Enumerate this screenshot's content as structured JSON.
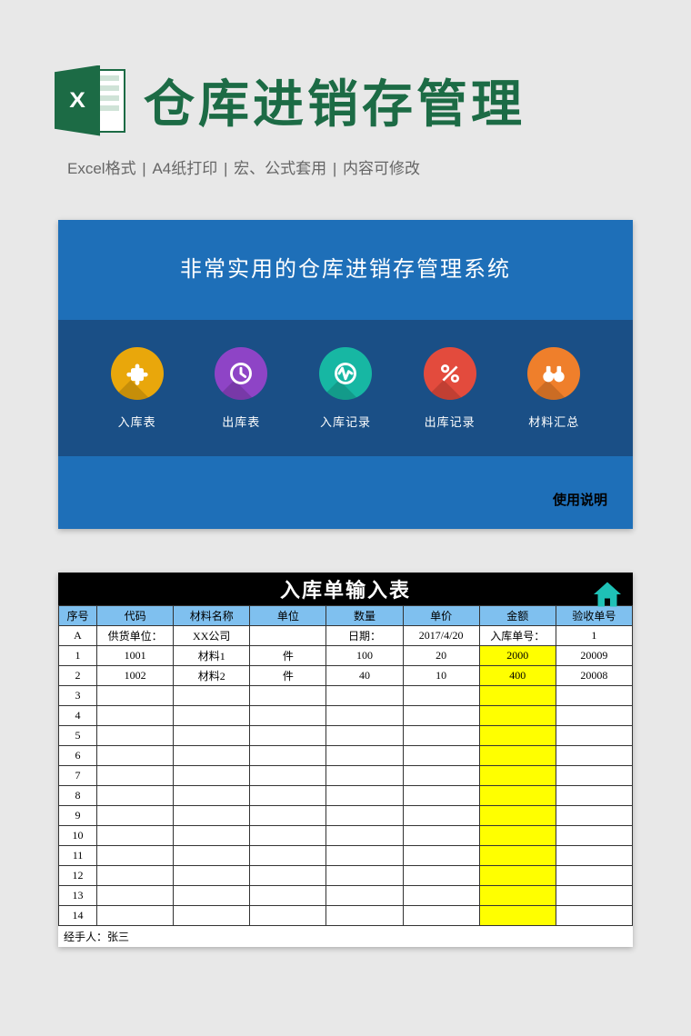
{
  "header": {
    "excel_letter": "X",
    "title": "仓库进销存管理",
    "subs": [
      "Excel格式",
      "A4纸打印",
      "宏、公式套用",
      "内容可修改"
    ]
  },
  "menu_card": {
    "title": "非常实用的仓库进销存管理系统",
    "items": [
      {
        "label": "入库表"
      },
      {
        "label": "出库表"
      },
      {
        "label": "入库记录"
      },
      {
        "label": "出库记录"
      },
      {
        "label": "材料汇总"
      }
    ],
    "help": "使用说明"
  },
  "sheet_card": {
    "title": "入库单输入表",
    "info": {
      "col_a": "A",
      "supplier_label": "供货单位：",
      "supplier_value": "XX公司",
      "date_label": "日期：",
      "date_value": "2017/4/20",
      "docno_label": "入库单号：",
      "docno_value": "1"
    },
    "columns": [
      "序号",
      "代码",
      "材料名称",
      "单位",
      "数量",
      "单价",
      "金额",
      "验收单号"
    ],
    "rows": [
      {
        "seq": "1",
        "code": "1001",
        "name": "材料1",
        "unit": "件",
        "qty": "100",
        "price": "20",
        "amount": "2000",
        "accept": "20009"
      },
      {
        "seq": "2",
        "code": "1002",
        "name": "材料2",
        "unit": "件",
        "qty": "40",
        "price": "10",
        "amount": "400",
        "accept": "20008"
      },
      {
        "seq": "3"
      },
      {
        "seq": "4"
      },
      {
        "seq": "5"
      },
      {
        "seq": "6"
      },
      {
        "seq": "7"
      },
      {
        "seq": "8"
      },
      {
        "seq": "9"
      },
      {
        "seq": "10"
      },
      {
        "seq": "11"
      },
      {
        "seq": "12"
      },
      {
        "seq": "13"
      },
      {
        "seq": "14"
      }
    ],
    "handler": "经手人：张三"
  }
}
